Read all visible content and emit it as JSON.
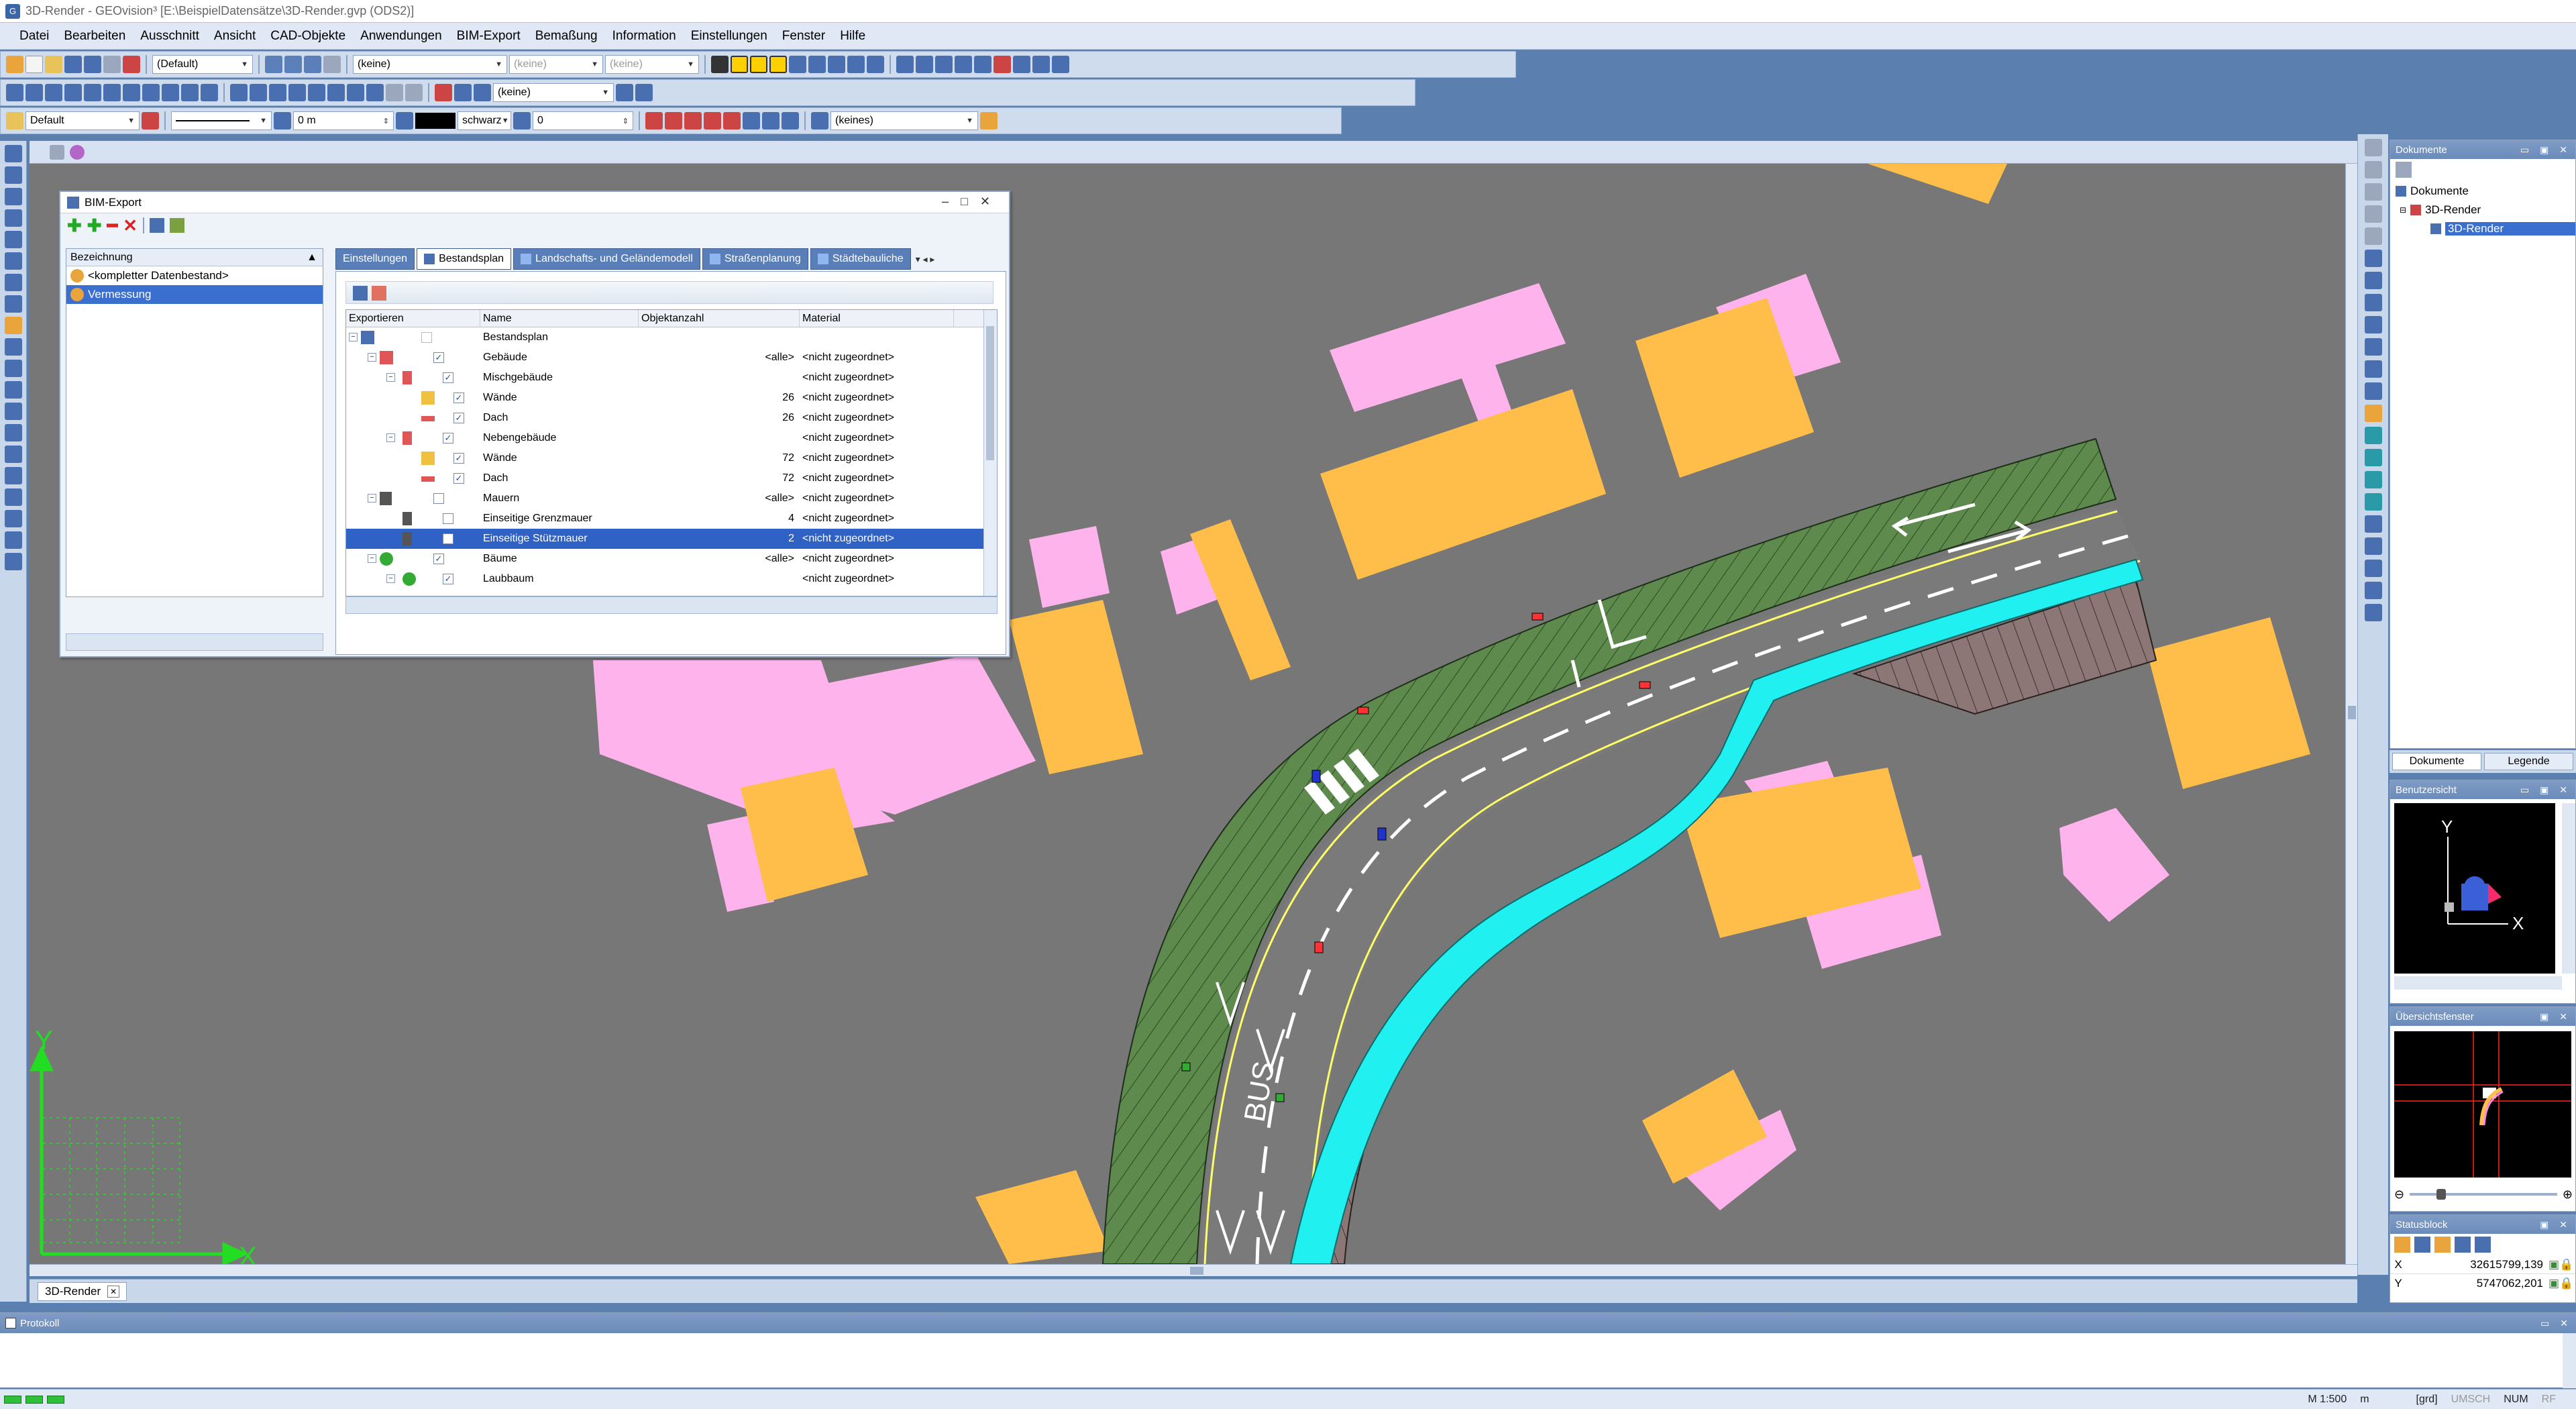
{
  "window": {
    "title": "3D-Render - GEOvision³ [E:\\BeispielDatensätze\\3D-Render.gvp (ODS2)]"
  },
  "menu": [
    "Datei",
    "Bearbeiten",
    "Ausschnitt",
    "Ansicht",
    "CAD-Objekte",
    "Anwendungen",
    "BIM-Export",
    "Bemaßung",
    "Information",
    "Einstellungen",
    "Fenster",
    "Hilfe"
  ],
  "toolbar": {
    "combo_default_paren": "(Default)",
    "combo_keine1": "(keine)",
    "combo_keine2": "(keine)",
    "combo_keine3": "(keine)",
    "combo_keine4": "(keine)",
    "combo_layer": "Default",
    "combo_height": "0 m",
    "combo_color": "schwarz",
    "combo_zero": "0",
    "combo_keines": "(keines)"
  },
  "bim": {
    "title": "BIM-Export",
    "left_header": "Bezeichnung",
    "left_items": [
      "<kompletter Datenbestand>",
      "Vermessung"
    ],
    "tabs": [
      "Einstellungen",
      "Bestandsplan",
      "Landschafts- und Geländemodell",
      "Straßenplanung",
      "Städtebauliche"
    ],
    "columns": {
      "exportieren": "Exportieren",
      "name": "Name",
      "count": "Objektanzahl",
      "material": "Material"
    },
    "rows": [
      {
        "name": "Bestandsplan",
        "count": "",
        "material": ""
      },
      {
        "name": "Gebäude",
        "count": "<alle>",
        "material": "<nicht zugeordnet>"
      },
      {
        "name": "Mischgebäude",
        "count": "",
        "material": "<nicht zugeordnet>"
      },
      {
        "name": "Wände",
        "count": "26",
        "material": "<nicht zugeordnet>"
      },
      {
        "name": "Dach",
        "count": "26",
        "material": "<nicht zugeordnet>"
      },
      {
        "name": "Nebengebäude",
        "count": "",
        "material": "<nicht zugeordnet>"
      },
      {
        "name": "Wände",
        "count": "72",
        "material": "<nicht zugeordnet>"
      },
      {
        "name": "Dach",
        "count": "72",
        "material": "<nicht zugeordnet>"
      },
      {
        "name": "Mauern",
        "count": "<alle>",
        "material": "<nicht zugeordnet>"
      },
      {
        "name": "Einseitige Grenzmauer",
        "count": "4",
        "material": "<nicht zugeordnet>"
      },
      {
        "name": "Einseitige Stützmauer",
        "count": "2",
        "material": "<nicht zugeordnet>"
      },
      {
        "name": "Bäume",
        "count": "<alle>",
        "material": "<nicht zugeordnet>"
      },
      {
        "name": "Laubbaum",
        "count": "",
        "material": "<nicht zugeordnet>"
      }
    ]
  },
  "documents": {
    "title": "Dokumente",
    "tree": [
      "Dokumente",
      "3D-Render",
      "3D-Render"
    ],
    "tabs": [
      "Dokumente",
      "Legende"
    ]
  },
  "userview": {
    "title": "Benutzersicht",
    "axis_y": "Y",
    "axis_x": "X"
  },
  "overview": {
    "title": "Übersichtsfenster"
  },
  "statusblock": {
    "title": "Statusblock",
    "x_label": "X",
    "x_value": "32615799,139",
    "y_label": "Y",
    "y_value": "5747062,201"
  },
  "viewport": {
    "axis_x": "X",
    "axis_y": "Y",
    "bus_text": "BUS"
  },
  "doc_tab": {
    "label": "3D-Render"
  },
  "protokoll": {
    "title": "Protokoll"
  },
  "statusbar": {
    "scale": "M 1:500",
    "unit": "m",
    "grd": "[grd]",
    "umsch": "UMSCH",
    "num": "NUM",
    "rf": "RF"
  },
  "colors": {
    "building_orange": "#ffbe4a",
    "building_pink": "#ffb3ec",
    "grass": "#5e8a4e",
    "water": "#20f0f0",
    "road": "#7a7a7a",
    "background": "#777777"
  }
}
